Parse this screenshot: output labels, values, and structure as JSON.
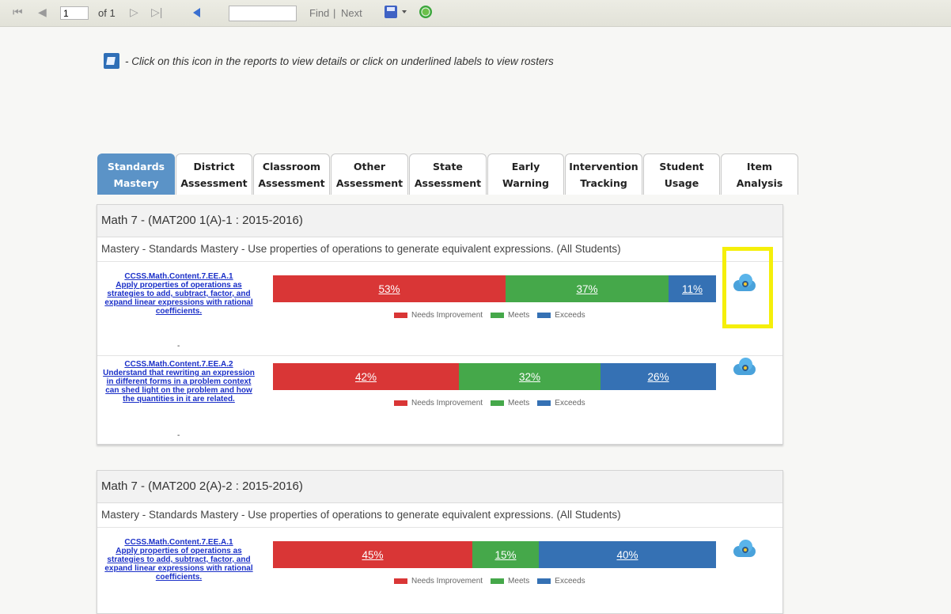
{
  "toolbar": {
    "first": "⏮",
    "prev": "◀",
    "page_value": "1",
    "of_pages": "of 1",
    "next": "▷",
    "last": "▷|",
    "find_label": "Find",
    "separator": "|",
    "next_label": "Next"
  },
  "help": {
    "text": " - Click on this icon in the reports to view details or click on underlined labels to view rosters"
  },
  "tabs": [
    {
      "line1": "Standards",
      "line2": "Mastery",
      "active": true
    },
    {
      "line1": "District",
      "line2": "Assessment",
      "active": false
    },
    {
      "line1": "Classroom",
      "line2": "Assessment",
      "active": false
    },
    {
      "line1": "Other",
      "line2": "Assessment",
      "active": false
    },
    {
      "line1": "State",
      "line2": "Assessment",
      "active": false
    },
    {
      "line1": "Early",
      "line2": "Warning",
      "active": false
    },
    {
      "line1": "Intervention",
      "line2": "Tracking",
      "active": false
    },
    {
      "line1": "Student",
      "line2": "Usage",
      "active": false
    },
    {
      "line1": "Item",
      "line2": "Analysis",
      "active": false
    }
  ],
  "legend": {
    "needs": "Needs Improvement",
    "meets": "Meets",
    "exceeds": "Exceeds"
  },
  "colors": {
    "needs": "#d93636",
    "meets": "#45a84a",
    "exceeds": "#3571b4",
    "highlight": "#f5ef0a",
    "active_tab": "#5b93c7"
  },
  "panels": [
    {
      "title": "Math 7 - (MAT200 1(A)-1 : 2015-2016)",
      "mastery": "Mastery - Standards Mastery - Use properties of operations to generate equivalent expressions. (All Students)",
      "rows": [
        {
          "code": "CCSS.Math.Content.7.EE.A.1",
          "desc": "Apply properties of operations as strategies to add, subtract, factor, and expand linear expressions with rational coefficients.",
          "dash": "-",
          "needs": "53%",
          "meets": "37%",
          "exceeds": "11%",
          "needs_pct": 53,
          "meets_pct": 37,
          "exceeds_pct": 11
        },
        {
          "code": "CCSS.Math.Content.7.EE.A.2",
          "desc": "Understand that rewriting an expression in different forms in a problem context can shed light on the problem and how the quantities in it are related.",
          "dash": "-",
          "needs": "42%",
          "meets": "32%",
          "exceeds": "26%",
          "needs_pct": 42,
          "meets_pct": 32,
          "exceeds_pct": 26
        }
      ]
    },
    {
      "title": "Math 7 - (MAT200 2(A)-2 : 2015-2016)",
      "mastery": "Mastery - Standards Mastery - Use properties of operations to generate equivalent expressions. (All Students)",
      "rows": [
        {
          "code": "CCSS.Math.Content.7.EE.A.1",
          "desc": "Apply properties of operations as strategies to add, subtract, factor, and expand linear expressions with rational coefficients.",
          "needs": "45%",
          "meets": "15%",
          "exceeds": "40%",
          "needs_pct": 45,
          "meets_pct": 15,
          "exceeds_pct": 40
        }
      ]
    }
  ]
}
